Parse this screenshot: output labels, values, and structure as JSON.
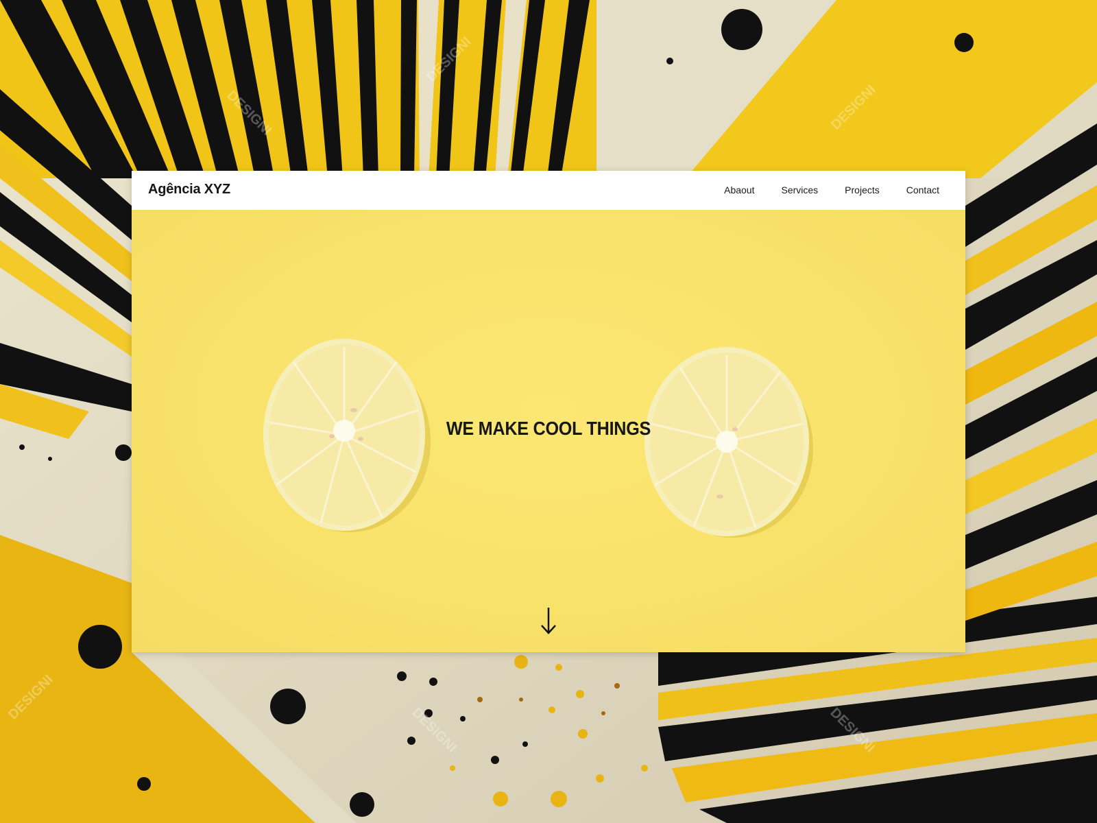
{
  "site": {
    "brand": "Agência XYZ",
    "nav": [
      {
        "label": "Abaout"
      },
      {
        "label": "Services"
      },
      {
        "label": "Projects"
      },
      {
        "label": "Contact"
      }
    ]
  },
  "hero": {
    "headline": "WE MAKE COOL THINGS",
    "scroll_icon": "arrow-down-icon",
    "image": "two-lemon-slices"
  },
  "backdrop": {
    "watermark": "DESIGNI",
    "colors": {
      "yellow": "#f2c21a",
      "black": "#111111",
      "cream": "#e4dcc2",
      "hero_yellow": "#fbe46e"
    }
  }
}
